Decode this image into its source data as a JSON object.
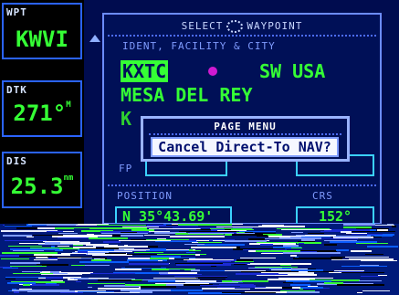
{
  "left_panel": {
    "wpt": {
      "label": "WPT",
      "value": "KWVI"
    },
    "dtk": {
      "label": "DTK",
      "value": "271°",
      "unit": "M"
    },
    "dis": {
      "label": "DIS",
      "value": "25.3",
      "unit": "nm"
    }
  },
  "window": {
    "title_left": "SELECT",
    "title_right": "WAYPOINT",
    "ident_header": "IDENT, FACILITY & CITY",
    "ident_cursor": "KXTC",
    "region": "SW USA",
    "facility": "MESA DEL REY",
    "position_header": "POSITION",
    "crs_header": "CRS",
    "fpl_label": "FP",
    "position_value": "N 35°43.69'",
    "crs_value": "152°"
  },
  "menu": {
    "title": "PAGE MENU",
    "item": "Cancel Direct-To NAV?"
  },
  "colors": {
    "accent_green": "#35ff35",
    "frame_blue": "#2b63ff",
    "highlight_magenta": "#d11ad1"
  },
  "icons": [
    "waypoint-knob-icon",
    "scroll-up-arrow-icon",
    "symbol-dot-icon"
  ]
}
